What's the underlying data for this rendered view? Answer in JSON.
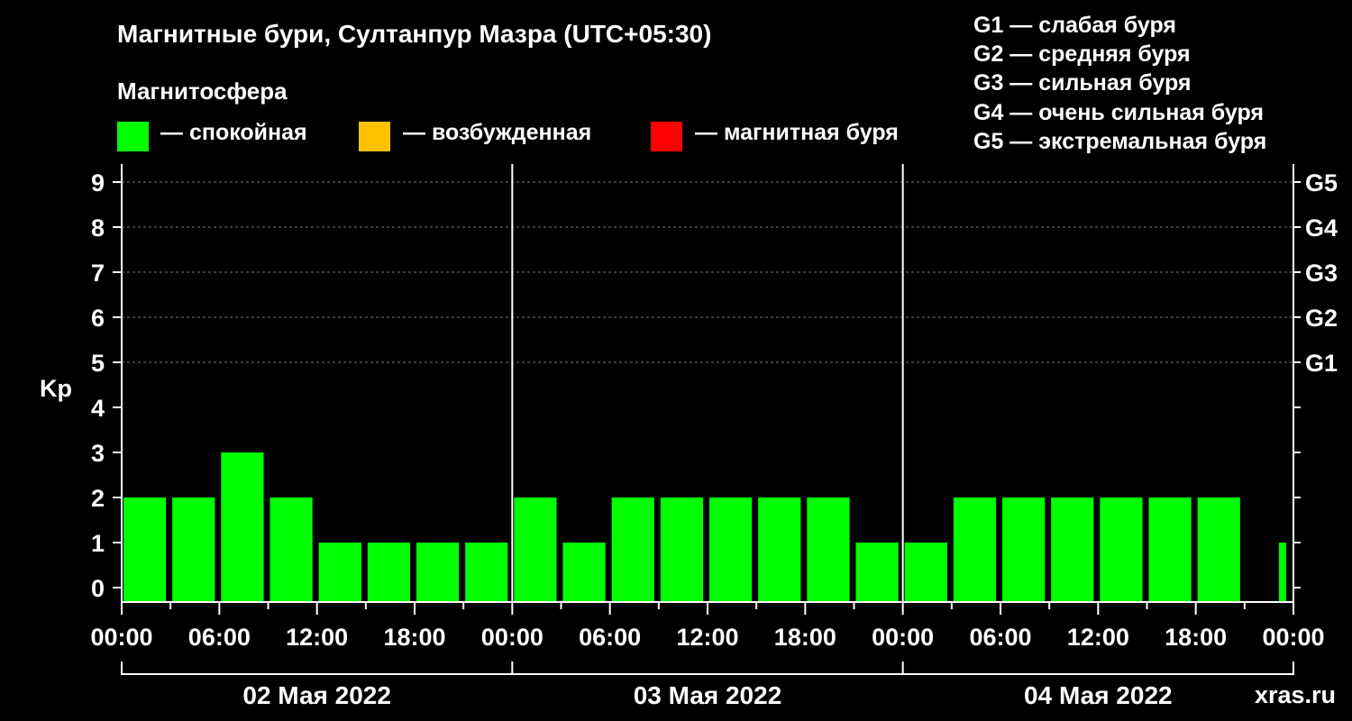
{
  "header": {
    "title": "Магнитные бури, Султанпур Мазра (UTC+05:30)",
    "subtitle": "Магнитосфера"
  },
  "legend": [
    {
      "color": "#00ff00",
      "label": "— спокойная"
    },
    {
      "color": "#ffc000",
      "label": "— возбужденная"
    },
    {
      "color": "#ff0000",
      "label": "— магнитная буря"
    }
  ],
  "g_legend": [
    "G1 — слабая буря",
    "G2 — средняя буря",
    "G3 — сильная буря",
    "G4 — очень сильная буря",
    "G5 — экстремальная буря"
  ],
  "watermark": "xras.ru",
  "chart_data": {
    "type": "bar",
    "ylabel": "Kp",
    "ylim": [
      0,
      9
    ],
    "y_ticks": [
      "0",
      "1",
      "2",
      "3",
      "4",
      "5",
      "6",
      "7",
      "8",
      "9"
    ],
    "right_ticks": [
      {
        "value": 5,
        "label": "G1"
      },
      {
        "value": 6,
        "label": "G2"
      },
      {
        "value": 7,
        "label": "G3"
      },
      {
        "value": 8,
        "label": "G4"
      },
      {
        "value": 9,
        "label": "G5"
      }
    ],
    "x_tick_labels": [
      "00:00",
      "06:00",
      "12:00",
      "18:00",
      "00:00",
      "06:00",
      "12:00",
      "18:00",
      "00:00",
      "06:00",
      "12:00",
      "18:00",
      "00:00"
    ],
    "days": [
      "02 Мая 2022",
      "03 Мая 2022",
      "04 Мая 2022"
    ],
    "grid": "dashed horizontal",
    "bar_color": "#00ff00",
    "bars": [
      {
        "time": "2022-05-02 00:00",
        "kp": 2
      },
      {
        "time": "2022-05-02 03:00",
        "kp": 2
      },
      {
        "time": "2022-05-02 06:00",
        "kp": 3
      },
      {
        "time": "2022-05-02 09:00",
        "kp": 2
      },
      {
        "time": "2022-05-02 12:00",
        "kp": 1
      },
      {
        "time": "2022-05-02 15:00",
        "kp": 1
      },
      {
        "time": "2022-05-02 18:00",
        "kp": 1
      },
      {
        "time": "2022-05-02 21:00",
        "kp": 1
      },
      {
        "time": "2022-05-03 00:00",
        "kp": 2
      },
      {
        "time": "2022-05-03 03:00",
        "kp": 1
      },
      {
        "time": "2022-05-03 06:00",
        "kp": 2
      },
      {
        "time": "2022-05-03 09:00",
        "kp": 2
      },
      {
        "time": "2022-05-03 12:00",
        "kp": 2
      },
      {
        "time": "2022-05-03 15:00",
        "kp": 2
      },
      {
        "time": "2022-05-03 18:00",
        "kp": 2
      },
      {
        "time": "2022-05-03 21:00",
        "kp": 1
      },
      {
        "time": "2022-05-04 00:00",
        "kp": 1
      },
      {
        "time": "2022-05-04 03:00",
        "kp": 2
      },
      {
        "time": "2022-05-04 06:00",
        "kp": 2
      },
      {
        "time": "2022-05-04 09:00",
        "kp": 2
      },
      {
        "time": "2022-05-04 12:00",
        "kp": 2
      },
      {
        "time": "2022-05-04 15:00",
        "kp": 2
      },
      {
        "time": "2022-05-04 18:00",
        "kp": 2
      },
      {
        "time": "2022-05-04 23:00",
        "kp": 1
      }
    ]
  }
}
